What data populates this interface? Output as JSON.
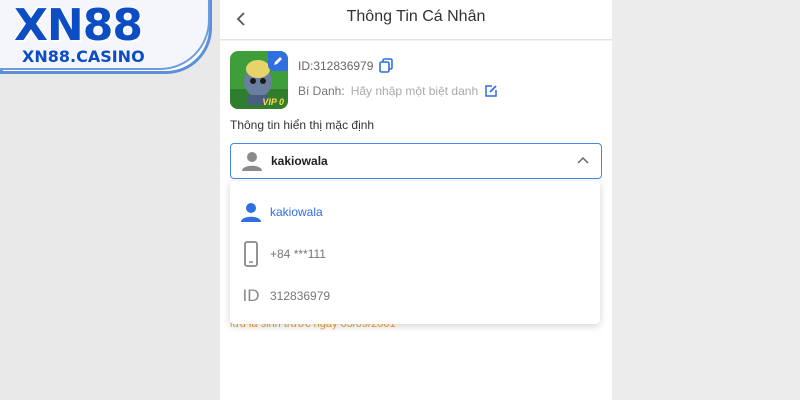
{
  "brand": {
    "name": "XN88",
    "sub": "XN88.CASINO"
  },
  "header": {
    "title": "Thông Tin Cá Nhân"
  },
  "profile": {
    "id_text": "ID:312836979",
    "nickname_label": "Bí Danh:",
    "nickname_placeholder": "Hãy nhập một biệt danh",
    "vip_badge": "VIP 0"
  },
  "default_info": {
    "label": "Thông tin hiển thị mặc định",
    "selected": "kakiowala",
    "options": [
      {
        "icon": "user-icon",
        "text": "kakiowala",
        "active": true
      },
      {
        "icon": "phone-icon",
        "text": "+84 ***111",
        "active": false
      },
      {
        "icon": "id-icon",
        "glyph": "ID",
        "text": "312836979",
        "active": false
      }
    ]
  },
  "hidden_note": "lưu là sinh trước ngày 03/09/2001",
  "colors": {
    "accent": "#2f6fe0",
    "brand": "#0d4dc3",
    "warning": "#f0a030"
  }
}
